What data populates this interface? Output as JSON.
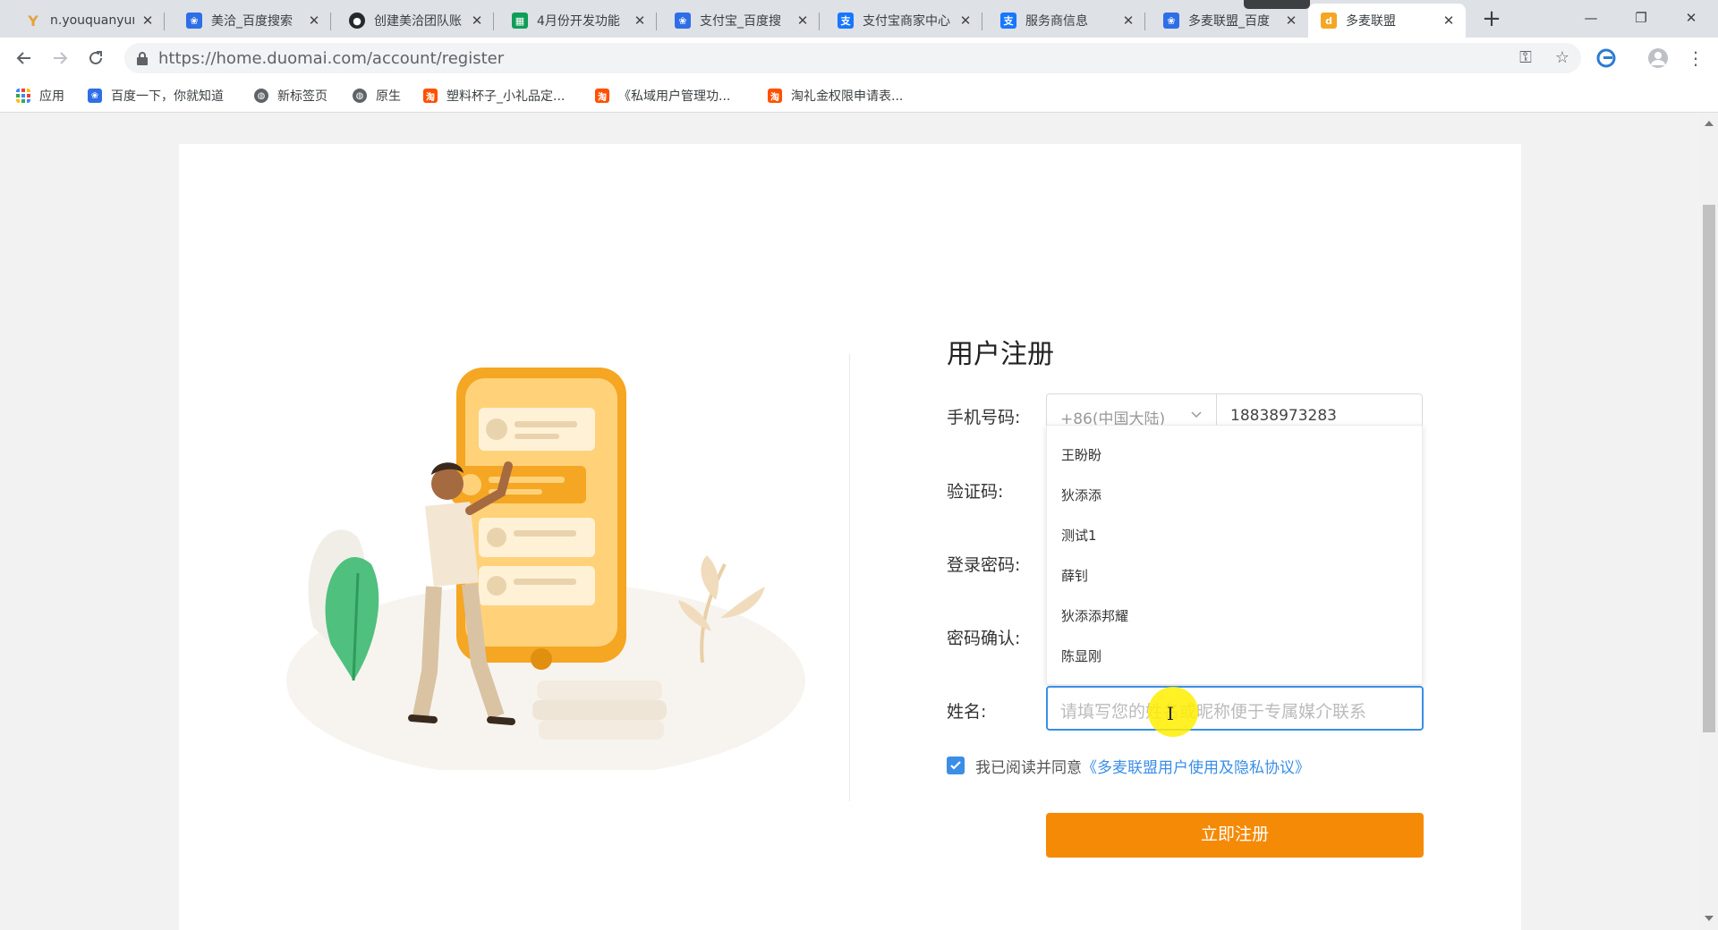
{
  "browser": {
    "tabs": [
      {
        "title": "n.youquanyun",
        "favicon": "youquanyun-icon",
        "color": "#e7a23a"
      },
      {
        "title": "美洽_百度搜索",
        "favicon": "baidu-paw-icon",
        "color": "#2e6ee6"
      },
      {
        "title": "创建美洽团队账",
        "favicon": "github-icon",
        "color": "#24292e"
      },
      {
        "title": "4月份开发功能",
        "favicon": "sheets-icon",
        "color": "#0f9d58"
      },
      {
        "title": "支付宝_百度搜",
        "favicon": "baidu-paw-icon",
        "color": "#2e6ee6"
      },
      {
        "title": "支付宝商家中心",
        "favicon": "alipay-icon",
        "color": "#1677ff"
      },
      {
        "title": "服务商信息",
        "favicon": "alipay-icon",
        "color": "#1677ff"
      },
      {
        "title": "多麦联盟_百度",
        "favicon": "baidu-paw-icon",
        "color": "#2e6ee6"
      },
      {
        "title": "多麦联盟",
        "favicon": "duomai-icon",
        "color": "#f5a623",
        "active": true
      }
    ],
    "url": "https://home.duomai.com/account/register",
    "bookmarks": [
      {
        "label": "应用",
        "icon": "apps-grid-icon"
      },
      {
        "label": "百度一下，你就知道",
        "icon": "baidu-paw-icon"
      },
      {
        "label": "新标签页",
        "icon": "globe-icon"
      },
      {
        "label": "原生",
        "icon": "globe-icon"
      },
      {
        "label": "塑料杯子_小礼品定...",
        "icon": "taobao-icon"
      },
      {
        "label": "《私域用户管理功...",
        "icon": "taobao-icon"
      },
      {
        "label": "淘礼金权限申请表...",
        "icon": "taobao-icon"
      }
    ]
  },
  "register": {
    "title": "用户注册",
    "phone_label": "手机号码:",
    "country_code": "+86(中国大陆)",
    "phone_value": "18838973283",
    "code_label": "验证码:",
    "password_label": "登录密码:",
    "confirm_label": "密码确认:",
    "name_label": "姓名:",
    "name_placeholder": "请填写您的姓名或昵称便于专属媒介联系",
    "autofill": [
      "王盼盼",
      "狄添添",
      "测试1",
      "薛钊",
      "狄添添邦耀",
      "陈显刚"
    ],
    "agree_text": "我已阅读并同意",
    "agree_link": "《多麦联盟用户使用及隐私协议》",
    "submit_label": "立即注册"
  },
  "colors": {
    "accent": "#3a8ee6",
    "submit": "#f58a07"
  }
}
